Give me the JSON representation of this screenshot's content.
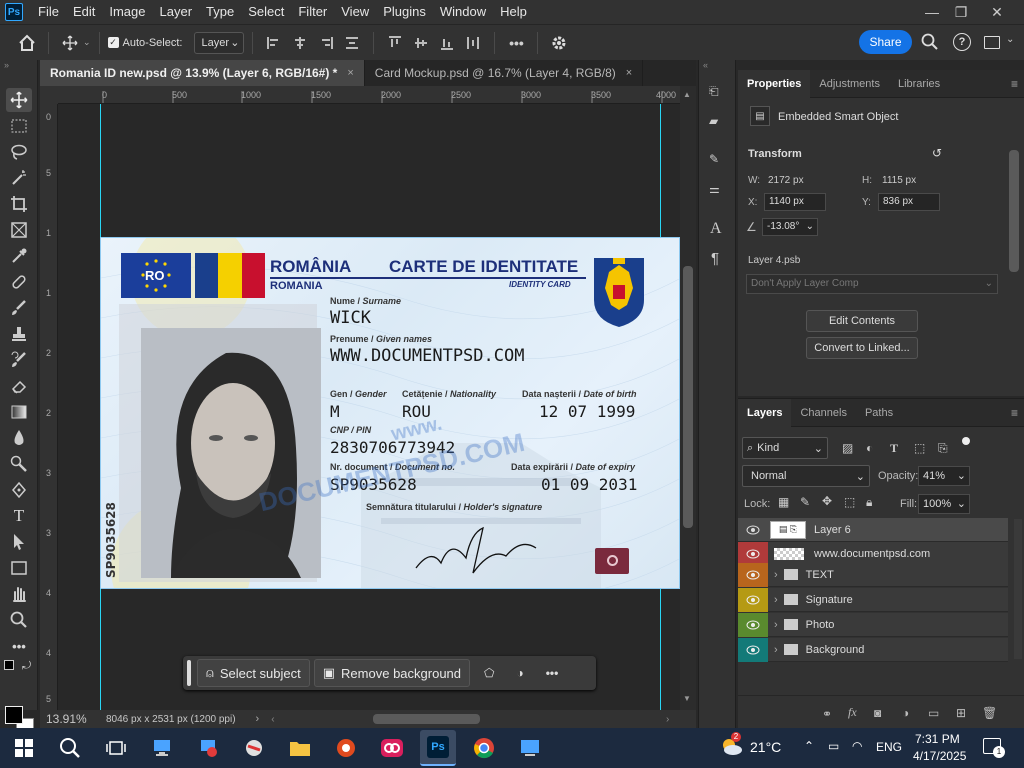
{
  "app": {
    "logo": "Ps"
  },
  "menu": [
    "File",
    "Edit",
    "Image",
    "Layer",
    "Type",
    "Select",
    "Filter",
    "View",
    "Plugins",
    "Window",
    "Help"
  ],
  "options": {
    "autoselect_label": "Auto-Select:",
    "autoselect_value": "Layer",
    "share": "Share",
    "more": "•••"
  },
  "tabs": [
    {
      "label": "Romania ID new.psd @ 13.9% (Layer 6, RGB/16#) *",
      "close": "×"
    },
    {
      "label": "Card Mockup.psd @ 16.7% (Layer 4, RGB/8)",
      "close": "×"
    }
  ],
  "ruler_h": [
    "0",
    "500",
    "1000",
    "1500",
    "2000",
    "2500",
    "3000",
    "3500",
    "4000"
  ],
  "ruler_v": [
    "0",
    "5",
    "1",
    "1",
    "2",
    "2",
    "3",
    "3",
    "4",
    "4",
    "5"
  ],
  "card": {
    "country_code": "RO",
    "country": "ROMÂNIA",
    "country_sub": "ROMANIA",
    "doc_title": "CARTE DE IDENTITATE",
    "doc_title_en": "IDENTITY CARD",
    "surname_label_ro": "Nume /",
    "surname_label_en": "Surname",
    "surname": "WICK",
    "given_label_ro": "Prenume /",
    "given_label_en": "Given names",
    "given": "WWW.DOCUMENTPSD.COM",
    "gender_label_ro": "Gen /",
    "gender_label_en": "Gender",
    "gender": "M",
    "nat_label_ro": "Cetățenie /",
    "nat_label_en": "Nationality",
    "nat": "ROU",
    "dob_label_ro": "Data nașterii /",
    "dob_label_en": "Date of birth",
    "dob": "12 07 1999",
    "cnp_label": "CNP / PIN",
    "cnp": "2830706773942",
    "docno_label_ro": "Nr. document /",
    "docno_label_en": "Document no.",
    "docno": "SP9035628",
    "exp_label_ro": "Data expirării /",
    "exp_label_en": "Date of expiry",
    "exp": "01 09 2031",
    "sig_label_ro": "Semnătura titularului /",
    "sig_label_en": "Holder's signature",
    "vertical_no": "SP9035628",
    "watermark": "DOCUMENTPSD.COM",
    "watermark2": "www."
  },
  "context_bar": {
    "select_subject": "Select subject",
    "remove_bg": "Remove background",
    "more": "•••"
  },
  "status": {
    "zoom": "13.91%",
    "info": "8046 px x 2531 px (1200 ppi)"
  },
  "properties": {
    "tabs": [
      "Properties",
      "Adjustments",
      "Libraries"
    ],
    "object_type": "Embedded Smart Object",
    "transform_label": "Transform",
    "w_label": "W:",
    "w": "2172 px",
    "h_label": "H:",
    "h": "1115 px",
    "x_label": "X:",
    "x": "1140 px",
    "y_label": "Y:",
    "y": "836 px",
    "angle": "-13.08°",
    "file": "Layer 4.psb",
    "comp": "Don't Apply Layer Comp",
    "edit": "Edit Contents",
    "convert": "Convert to Linked..."
  },
  "layers_panel": {
    "tabs": [
      "Layers",
      "Channels",
      "Paths"
    ],
    "kind": "Kind",
    "blend": "Normal",
    "opacity_label": "Opacity:",
    "opacity": "41%",
    "lock_label": "Lock:",
    "fill_label": "Fill:",
    "fill": "100%",
    "layers": [
      {
        "name": "Layer 6",
        "color": "#3a3a3a"
      },
      {
        "name": "www.documentpsd.com",
        "color": "#b03a3a"
      },
      {
        "name": "TEXT",
        "color": "#b8651d"
      },
      {
        "name": "Signature",
        "color": "#b59a14"
      },
      {
        "name": "Photo",
        "color": "#5a8a2e"
      },
      {
        "name": "Background",
        "color": "#137a78"
      }
    ]
  },
  "taskbar": {
    "temp": "21°C",
    "lang": "ENG",
    "time": "7:31 PM",
    "date": "4/17/2025",
    "weather_badge": "2",
    "notif": "1"
  }
}
